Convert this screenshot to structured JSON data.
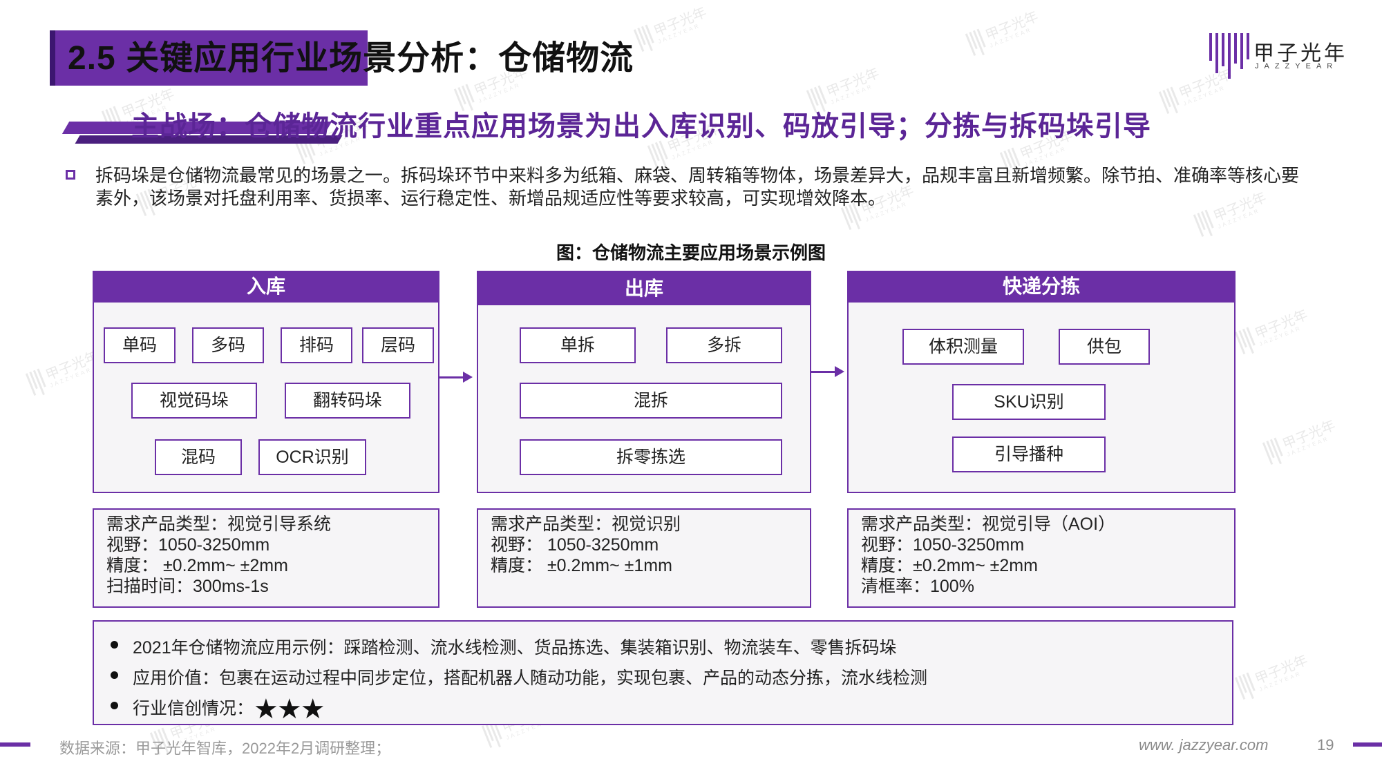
{
  "slide": {
    "title": "2.5 关键应用行业场景分析：仓储物流",
    "subtitle": "主战场：仓储物流行业重点应用场景为出入库识别、码放引导；分拣与拆码垛引导",
    "paragraph": "拆码垛是仓储物流最常见的场景之一。拆码垛环节中来料多为纸箱、麻袋、周转箱等物体，场景差异大，品规丰富且新增频繁。除节拍、准确率等核心要素外，该场景对托盘利用率、货损率、运行稳定性、新增品规适应性等要求较高，可实现增效降本。",
    "figure_title": "图：仓储物流主要应用场景示例图"
  },
  "logo": {
    "name": "甲子光年",
    "sub": "JAZZYEAR"
  },
  "watermark": {
    "text": "甲子光年",
    "sub": "JAZZYEAR"
  },
  "panels": {
    "inbound": {
      "title": "入库",
      "tags": [
        "单码",
        "多码",
        "排码",
        "层码",
        "视觉码垛",
        "翻转码垛",
        "混码",
        "OCR识别"
      ],
      "specs": [
        "需求产品类型：视觉引导系统",
        "视野：1050-3250mm",
        "精度：  ±0.2mm~ ±2mm",
        "扫描时间：300ms-1s"
      ]
    },
    "outbound": {
      "title": "出库",
      "tags": [
        "单拆",
        "多拆",
        "混拆",
        "拆零拣选"
      ],
      "specs": [
        "需求产品类型：视觉识别",
        "视野：  1050-3250mm",
        "精度：  ±0.2mm~ ±1mm"
      ]
    },
    "express": {
      "title": "快递分拣",
      "tags": [
        "体积测量",
        "供包",
        "SKU识别",
        "引导播种"
      ],
      "specs": [
        "需求产品类型：视觉引导（AOI）",
        "视野：1050-3250mm",
        "精度：±0.2mm~ ±2mm",
        "清框率：100%"
      ]
    }
  },
  "bottom": {
    "items": [
      "2021年仓储物流应用示例：踩踏检测、流水线检测、货品拣选、集装箱识别、物流装车、零售拆码垛",
      "应用价值：包裹在运动过程中同步定位，搭配机器人随动功能，实现包裹、产品的动态分拣，流水线检测",
      "行业信创情况："
    ],
    "rating_stars": "★★★",
    "rating_value": 3
  },
  "footer": {
    "source": "数据来源：甲子光年智库，2022年2月调研整理；",
    "website": "www. jazzyear.com",
    "page_number": "19"
  },
  "colors": {
    "accent": "#6b2fa6",
    "accent_dark": "#3c1670",
    "panel_bg": "#f6f5f7"
  }
}
